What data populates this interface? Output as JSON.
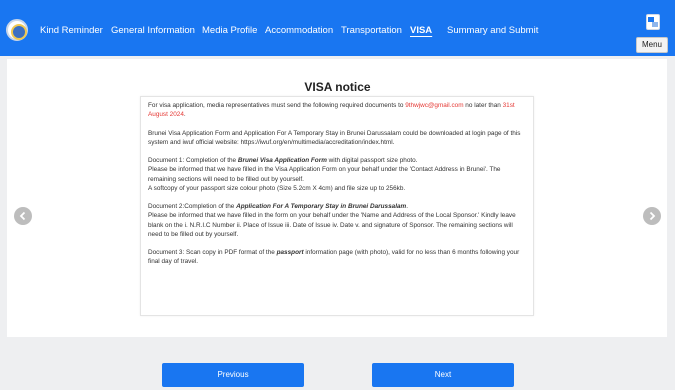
{
  "nav": {
    "items": [
      {
        "label": "Kind Reminder"
      },
      {
        "label": "General Information"
      },
      {
        "label": "Media Profile"
      },
      {
        "label": "Accommodation"
      },
      {
        "label": "Transportation"
      },
      {
        "label": "VISA"
      },
      {
        "label": "Summary and Submit"
      }
    ],
    "active": "VISA",
    "menu_label": "Menu"
  },
  "notice": {
    "title": "VISA notice",
    "p1": {
      "pre": "For visa application, media representatives must send the following required documents to ",
      "email": "9thwjwc@gmail.com",
      "mid": " no later than ",
      "date": "31st August 2024",
      "end": "."
    },
    "p2": "Brunei Visa Application Form and Application For A Temporary Stay in Brunei Darussalam could be downloaded at login page of this system and iwuf official website: https://iwuf.org/en/multimedia/accreditation/index.html.",
    "doc1": {
      "pre": "Document 1: Completion of the ",
      "form": "Brunei Visa Application Form",
      "post": " with digital passport size photo.",
      "line2": "Please be informed that we have filled in the Visa Application Form on your behalf under the 'Contact Address in Brunei'. The remaining sections will need to be filled out by yourself.",
      "line3": "A softcopy of your passport size colour photo (Size 5.2cm X 4cm) and file size up to 256kb."
    },
    "doc2": {
      "pre": "Document 2:Completion of the ",
      "form": "Application For A Temporary Stay in Brunei Darussalam",
      "post": ".",
      "line2": "Please be informed that we have filled in the form on your behalf under the 'Name and Address of the Local Sponsor.' Kindly leave blank on the i. N.R.I.C Number ii. Place of Issue iii. Date of Issue iv. Date v. and signature of Sponsor. The remaining sections will need to be filled out by yourself."
    },
    "doc3": {
      "pre": "Document 3: Scan copy in PDF format of the ",
      "emph": "passport",
      "post": " information page (with photo), valid for no less than 6 months following your final day of travel."
    }
  },
  "buttons": {
    "previous": "Previous",
    "next": "Next"
  },
  "colors": {
    "primary": "#1976f1",
    "highlight": "#e53935"
  }
}
